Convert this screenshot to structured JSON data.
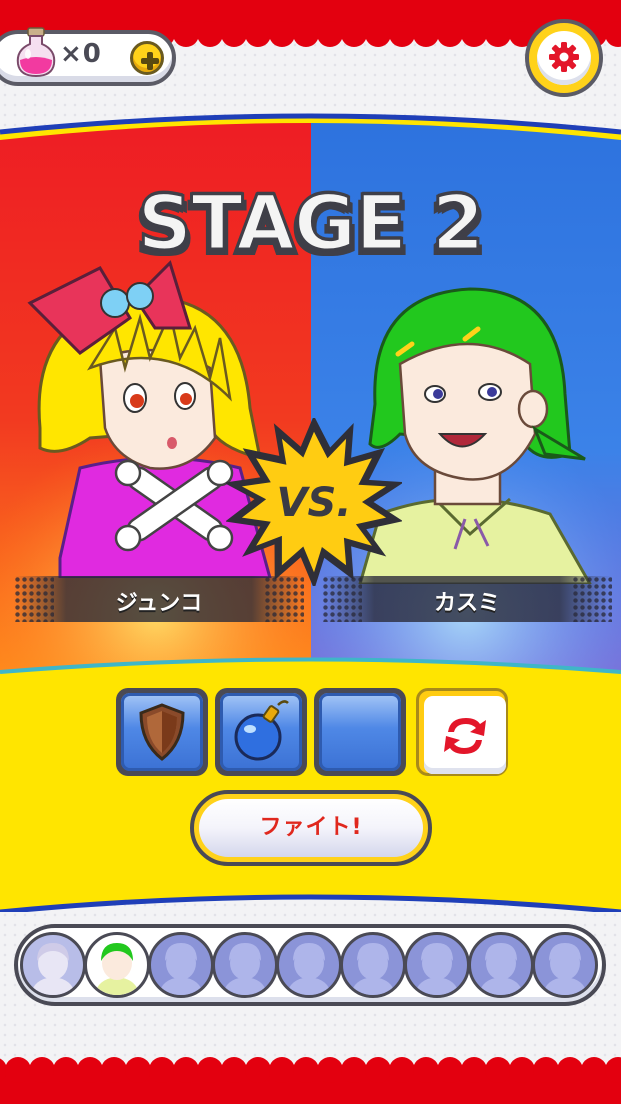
{
  "hud": {
    "potion_count": "×0",
    "add_icon": "plus-icon",
    "settings_icon": "gear-icon"
  },
  "stage": {
    "title": "STAGE 2",
    "vs_label": "VS."
  },
  "fighters": {
    "player": {
      "name": "ジュンコ",
      "side_color": "#f0262a"
    },
    "opponent": {
      "name": "カスミ",
      "side_color": "#2f74e0"
    }
  },
  "items": [
    {
      "icon": "shield-icon",
      "state": "owned"
    },
    {
      "icon": "bomb-icon",
      "state": "owned"
    },
    {
      "icon": "",
      "state": "empty"
    },
    {
      "icon": "refresh-icon",
      "state": "action"
    }
  ],
  "fight_button": {
    "label": "ファイト!"
  },
  "roster": {
    "total": 9,
    "completed": 1,
    "current_index": 1
  },
  "colors": {
    "accent_yellow": "#ffd21a",
    "frame_red": "#e3000f",
    "panel_yellow": "#ffe500",
    "outline": "#4a4a55"
  }
}
